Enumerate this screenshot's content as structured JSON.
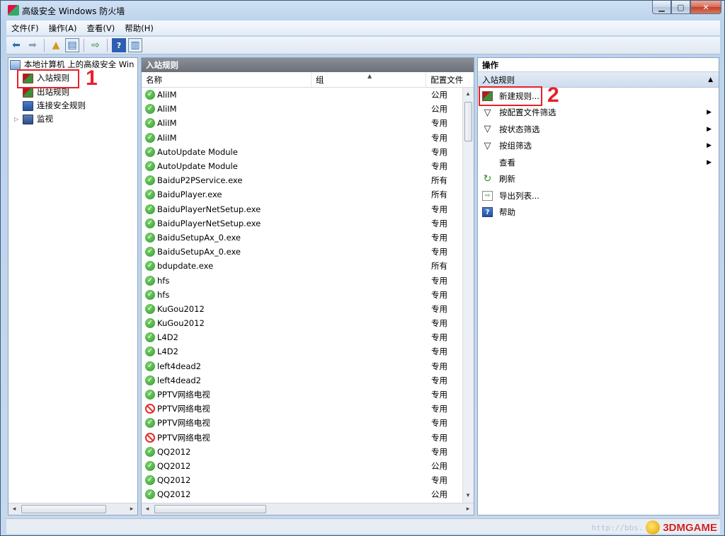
{
  "window": {
    "title": "高级安全 Windows 防火墙"
  },
  "menu": [
    "文件(F)",
    "操作(A)",
    "查看(V)",
    "帮助(H)"
  ],
  "tree": {
    "root": "本地计算机 上的高级安全 Win",
    "items": [
      "入站规则",
      "出站规则",
      "连接安全规则",
      "监视"
    ]
  },
  "list": {
    "header": "入站规则",
    "columns": [
      "名称",
      "组",
      "配置文件"
    ],
    "rows": [
      {
        "name": "AliIM",
        "profile": "公用",
        "status": "enabled"
      },
      {
        "name": "AliIM",
        "profile": "公用",
        "status": "enabled"
      },
      {
        "name": "AliIM",
        "profile": "专用",
        "status": "enabled"
      },
      {
        "name": "AliIM",
        "profile": "专用",
        "status": "enabled"
      },
      {
        "name": "AutoUpdate Module",
        "profile": "专用",
        "status": "enabled"
      },
      {
        "name": "AutoUpdate Module",
        "profile": "专用",
        "status": "enabled"
      },
      {
        "name": "BaiduP2PService.exe",
        "profile": "所有",
        "status": "enabled"
      },
      {
        "name": "BaiduPlayer.exe",
        "profile": "所有",
        "status": "enabled"
      },
      {
        "name": "BaiduPlayerNetSetup.exe",
        "profile": "专用",
        "status": "enabled"
      },
      {
        "name": "BaiduPlayerNetSetup.exe",
        "profile": "专用",
        "status": "enabled"
      },
      {
        "name": "BaiduSetupAx_0.exe",
        "profile": "专用",
        "status": "enabled"
      },
      {
        "name": "BaiduSetupAx_0.exe",
        "profile": "专用",
        "status": "enabled"
      },
      {
        "name": "bdupdate.exe",
        "profile": "所有",
        "status": "enabled"
      },
      {
        "name": "hfs",
        "profile": "专用",
        "status": "enabled"
      },
      {
        "name": "hfs",
        "profile": "专用",
        "status": "enabled"
      },
      {
        "name": "KuGou2012",
        "profile": "专用",
        "status": "enabled"
      },
      {
        "name": "KuGou2012",
        "profile": "专用",
        "status": "enabled"
      },
      {
        "name": "L4D2",
        "profile": "专用",
        "status": "enabled"
      },
      {
        "name": "L4D2",
        "profile": "专用",
        "status": "enabled"
      },
      {
        "name": "left4dead2",
        "profile": "专用",
        "status": "enabled"
      },
      {
        "name": "left4dead2",
        "profile": "专用",
        "status": "enabled"
      },
      {
        "name": "PPTV网络电视",
        "profile": "专用",
        "status": "enabled"
      },
      {
        "name": "PPTV网络电视",
        "profile": "专用",
        "status": "blocked"
      },
      {
        "name": "PPTV网络电视",
        "profile": "专用",
        "status": "enabled"
      },
      {
        "name": "PPTV网络电视",
        "profile": "专用",
        "status": "blocked"
      },
      {
        "name": "QQ2012",
        "profile": "专用",
        "status": "enabled"
      },
      {
        "name": "QQ2012",
        "profile": "公用",
        "status": "enabled"
      },
      {
        "name": "QQ2012",
        "profile": "专用",
        "status": "enabled"
      },
      {
        "name": "QQ2012",
        "profile": "公用",
        "status": "enabled"
      }
    ]
  },
  "actions": {
    "header": "操作",
    "section": "入站规则",
    "items": [
      "新建规则...",
      "按配置文件筛选",
      "按状态筛选",
      "按组筛选",
      "查看",
      "刷新",
      "导出列表...",
      "帮助"
    ]
  },
  "annotations": {
    "step1": "1",
    "step2": "2"
  },
  "watermark": {
    "url": "http://bbs.",
    "brand": "3DMGAME"
  },
  "colors": {
    "annotation_red": "#e8202a",
    "enabled_green": "#2f9a2f",
    "blocked_red": "#e0302a"
  }
}
